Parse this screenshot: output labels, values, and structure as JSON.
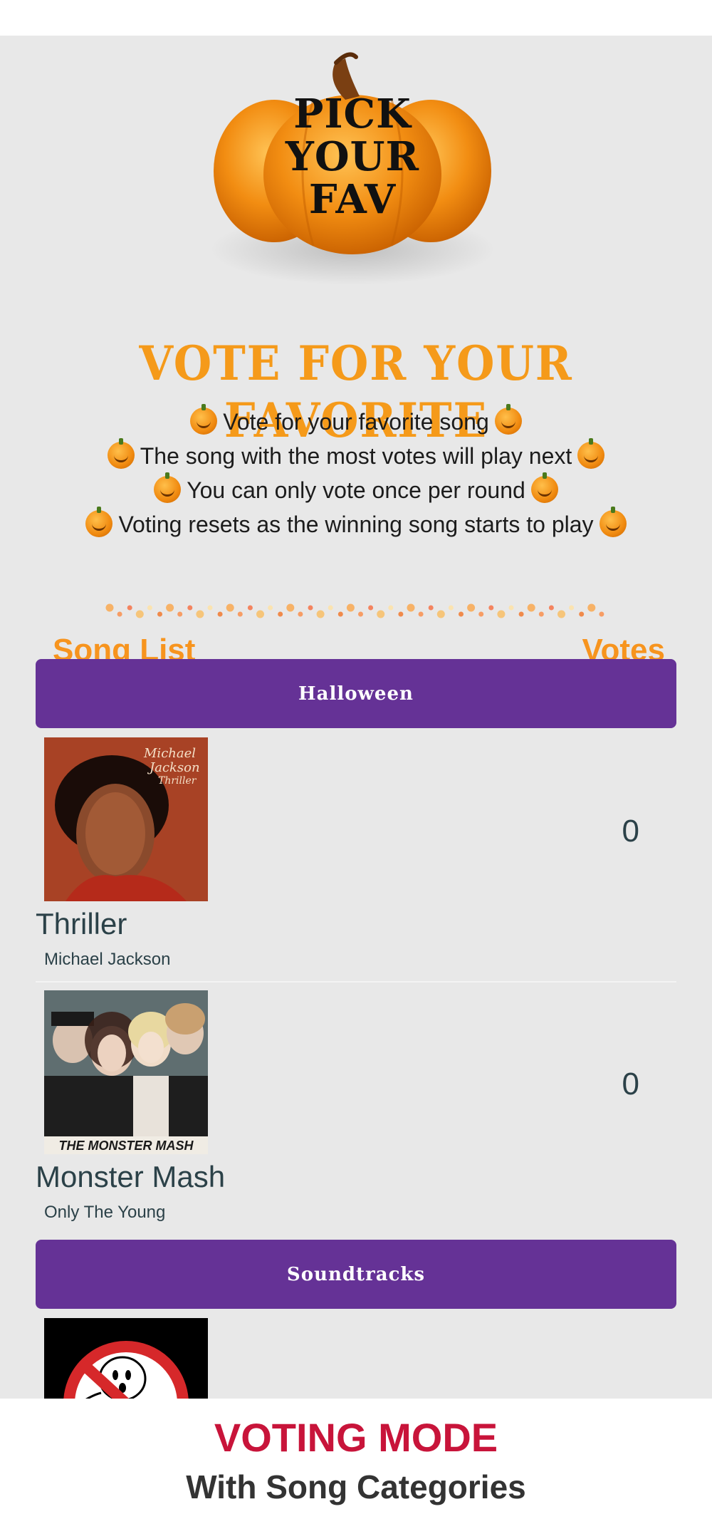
{
  "logo": {
    "line1": "PICK",
    "line2": "YOUR",
    "line3": "FAV"
  },
  "headline": "VOTE FOR YOUR FAVORITE",
  "rules": [
    "Vote for your favorite song",
    "The song with the most votes will play next",
    "You can only vote once per round",
    "Voting resets as the winning song starts to play"
  ],
  "list_header": {
    "left": "Song List",
    "right": "Votes"
  },
  "categories": [
    {
      "name": "Halloween",
      "songs": [
        {
          "title": "Thriller",
          "artist": "Michael Jackson",
          "votes": "0",
          "art_text": [
            "Michael",
            "Jackson",
            "Thriller"
          ]
        },
        {
          "title": "Monster Mash",
          "artist": "Only The Young",
          "votes": "0",
          "art_text": [
            "THE MONSTER MASH"
          ]
        }
      ]
    },
    {
      "name": "Soundtracks",
      "songs": []
    }
  ],
  "caption": {
    "mode": "VOTING MODE",
    "sub": "With Song Categories"
  },
  "colors": {
    "accent": "#f7941e",
    "category_bg": "#653296",
    "caption_red": "#c8143a",
    "screen_bg": "#e8e8e8"
  }
}
